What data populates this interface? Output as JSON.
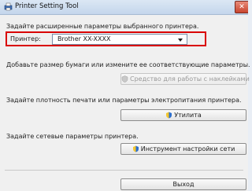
{
  "window": {
    "title": "Printer Setting Tool",
    "close_glyph": "✕"
  },
  "section_printer": {
    "caption": "Задайте расширенные параметры выбранного принтера.",
    "printer_label": "Принтер:",
    "printer_value": "Brother  XX-XXXX"
  },
  "section_paper": {
    "caption": "Добавьте размер бумаги или измените ее соответствующие параметры.",
    "button_label": "Средство для работы с наклейками",
    "button_enabled": false
  },
  "section_utility": {
    "caption": "Задайте плотность печати или параметры электропитания принтера.",
    "button_label": "Утилита"
  },
  "section_network": {
    "caption": "Задайте сетевые параметры принтера.",
    "button_label": "Инструмент настройки сети"
  },
  "footer": {
    "exit_label": "Выход"
  },
  "colors": {
    "highlight_border": "#d90000"
  },
  "icons": [
    "printer-app-icon",
    "shield-icon",
    "close-icon",
    "chevron-down-icon"
  ]
}
